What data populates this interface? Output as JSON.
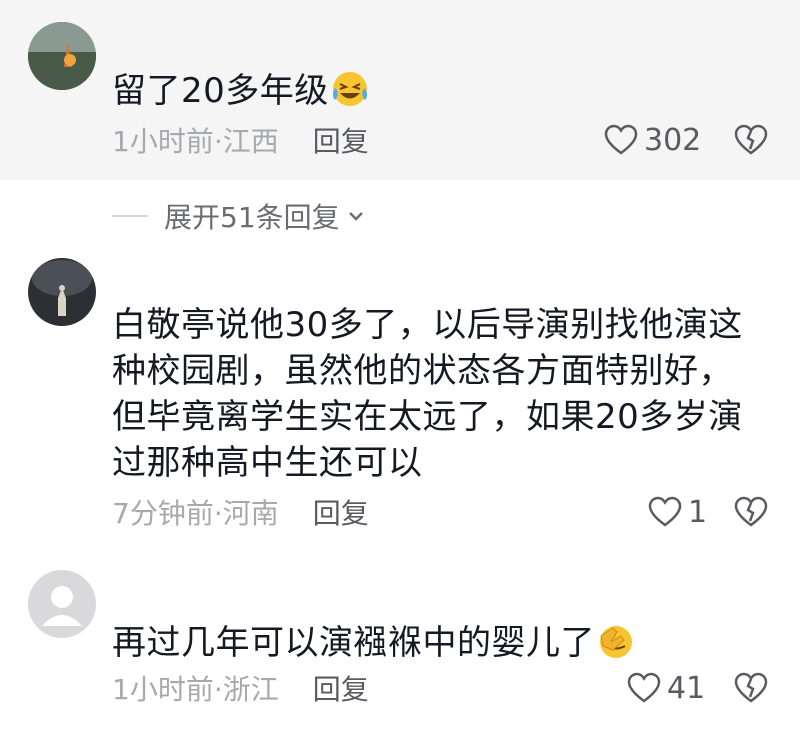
{
  "comments": [
    {
      "text": "留了20多年级",
      "emoji": "laughing-crying-emoji",
      "time_location": "1小时前·江西",
      "reply_label": "回复",
      "likes": "302"
    },
    {
      "text": "白敬亭说他30多了，以后导演别找他演这种校园剧，虽然他的状态各方面特别好，但毕竟离学生实在太远了，如果20多岁演过那种高中生还可以",
      "time_location": "7分钟前·河南",
      "reply_label": "回复",
      "likes": "1"
    },
    {
      "text": "再过几年可以演襁褓中的婴儿了",
      "emoji": "facepalm-emoji",
      "time_location": "1小时前·浙江",
      "reply_label": "回复",
      "likes": "41"
    }
  ],
  "expand_replies": {
    "label": "展开51条回复"
  },
  "colors": {
    "highlight_bg": "#f5f5f5",
    "text": "#161823",
    "meta": "#a8a9ad"
  }
}
